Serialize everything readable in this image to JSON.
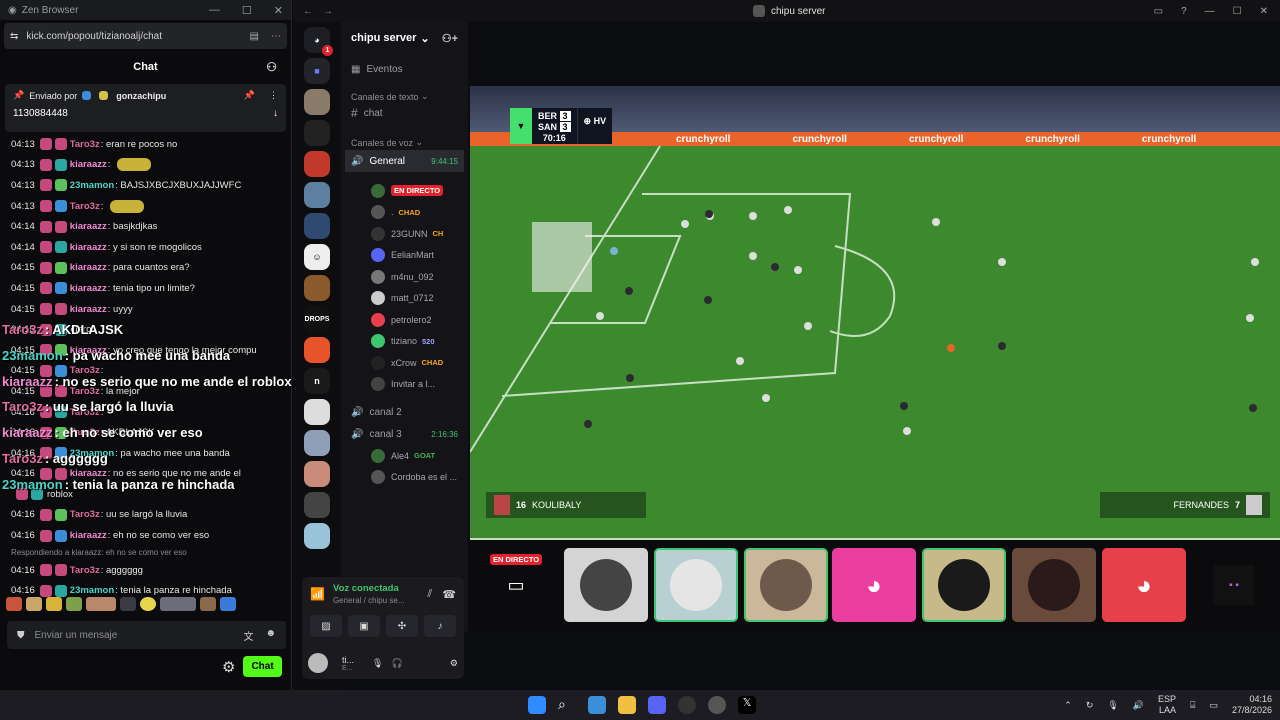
{
  "browser": {
    "title": "Zen Browser",
    "url": "kick.com/popout/tizianoalj/chat"
  },
  "kick": {
    "header": "Chat",
    "pinned": {
      "label": "Enviado por",
      "user": "gonzachipu",
      "text": "1130884448"
    },
    "messages": [
      {
        "time": "04:13",
        "user": "Taro3z",
        "color": "#e06c9f",
        "text": "eran re pocos no"
      },
      {
        "time": "04:13",
        "user": "kiaraazz",
        "color": "#f08ad0",
        "text": "",
        "emote": true
      },
      {
        "time": "04:13",
        "user": "23mamon",
        "color": "#4fd3c7",
        "text": "BAJSJXBCJXBUXJAJJWFC"
      },
      {
        "time": "04:13",
        "user": "Taro3z",
        "color": "#e06c9f",
        "text": "",
        "emote": true
      },
      {
        "time": "04:14",
        "user": "kiaraazz",
        "color": "#f08ad0",
        "text": "basjkdjkas"
      },
      {
        "time": "04:14",
        "user": "kiaraazz",
        "color": "#f08ad0",
        "text": "y si son re mogolicos"
      },
      {
        "time": "04:15",
        "user": "kiaraazz",
        "color": "#f08ad0",
        "text": "para cuantos era?"
      },
      {
        "time": "04:15",
        "user": "kiaraazz",
        "color": "#f08ad0",
        "text": "tenia tipo un limite?"
      },
      {
        "time": "04:15",
        "user": "kiaraazz",
        "color": "#f08ad0",
        "text": "uyyy"
      },
      {
        "time": "04:15",
        "user": "",
        "color": "#e06c9f",
        "text": "claro"
      },
      {
        "time": "04:15",
        "user": "kiaraazz",
        "color": "#f08ad0",
        "text": "yo creo que tengo la mejor compu"
      },
      {
        "time": "04:15",
        "user": "Taro3z",
        "color": "#e06c9f",
        "text": ""
      },
      {
        "time": "04:15",
        "user": "Taro3z",
        "color": "#e06c9f",
        "text": "la mejor"
      },
      {
        "time": "04:16",
        "user": "Taro3z",
        "color": "#e06c9f",
        "text": ""
      },
      {
        "time": "04:16",
        "user": "Taro3z",
        "color": "#e06c9f",
        "text": "AKDLAJSK"
      },
      {
        "time": "04:16",
        "user": "23mamon",
        "color": "#4fd3c7",
        "text": "pa wacho mee una banda"
      },
      {
        "time": "04:16",
        "user": "kiaraazz",
        "color": "#f08ad0",
        "text": "no es serio que no me ande el"
      },
      {
        "time": "",
        "user": "",
        "color": "#ddd",
        "text": "roblox"
      },
      {
        "time": "04:16",
        "user": "Taro3z",
        "color": "#e06c9f",
        "text": "uu se largó la lluvia"
      },
      {
        "time": "04:16",
        "user": "kiaraazz",
        "color": "#f08ad0",
        "text": "eh no se como ver eso"
      }
    ],
    "reply_note": "Respondiendo a kiaraazz: eh no se como ver eso",
    "messages_tail": [
      {
        "time": "04:16",
        "user": "Taro3z",
        "color": "#e06c9f",
        "text": "agggggg"
      },
      {
        "time": "04:16",
        "user": "23mamon",
        "color": "#4fd3c7",
        "text": "tenia la panza re hinchada"
      }
    ],
    "overlay": [
      {
        "user": "Taro3z",
        "color": "#e06c9f",
        "text": "AKDLAJSK"
      },
      {
        "user": "23mamon",
        "color": "#4fd3c7",
        "text": "pa wacho mee una banda"
      },
      {
        "user": "kiaraazz",
        "color": "#f08ad0",
        "text": "no es serio que no me ande el roblox"
      },
      {
        "user": "Taro3z",
        "color": "#e06c9f",
        "text": "uu se largó la lluvia"
      },
      {
        "user": "kiaraazz",
        "color": "#f08ad0",
        "text": "eh no se como ver eso"
      },
      {
        "user": "Taro3z",
        "color": "#e06c9f",
        "text": "agggggg"
      },
      {
        "user": "23mamon",
        "color": "#4fd3c7",
        "text": "tenia la panza re hinchada"
      }
    ],
    "send_placeholder": "Enviar un mensaje",
    "send_button": "Chat"
  },
  "discord": {
    "window_title": "chipu server",
    "server_name": "chipu server",
    "events": "Eventos",
    "text_category": "Canales de texto",
    "text_channel": "chat",
    "voice_category": "Canales de voz",
    "voice_channels": [
      {
        "name": "General",
        "timer": "9:44:15"
      },
      {
        "name": "canal 2",
        "timer": ""
      },
      {
        "name": "canal 3",
        "timer": "2:16:36"
      }
    ],
    "general_users": [
      {
        "name": "",
        "tag": "EN DIRECTO",
        "tag_color": "#e0232e"
      },
      {
        "name": ".",
        "tag": "CHAD",
        "tag_color": "#f5a623"
      },
      {
        "name": "23GUNN",
        "tag": "CH",
        "tag_color": "#f5a623"
      },
      {
        "name": "EelianMart",
        "tag": "",
        "tag_color": "#f5a623"
      },
      {
        "name": "m4nu_092",
        "tag": "",
        "tag_color": "#888"
      },
      {
        "name": "matt_0712",
        "tag": "",
        "tag_color": "#888"
      },
      {
        "name": "petrolero2",
        "tag": "",
        "tag_color": "#888"
      },
      {
        "name": "tiziano",
        "tag": "520",
        "tag_color": "#9aa2ff"
      },
      {
        "name": "xCrow",
        "tag": "CHAD",
        "tag_color": "#f5a623"
      },
      {
        "name": "Invitar a l...",
        "tag": "",
        "tag_color": "#888"
      }
    ],
    "canal3_users": [
      {
        "name": "Ale4",
        "tag": "GOAT",
        "tag_color": "#4caf50"
      },
      {
        "name": "Cordoba es el ...",
        "tag": "",
        "tag_color": "#888"
      }
    ],
    "voice_panel": {
      "status": "Voz conectada",
      "where": "General / chipu se..."
    },
    "user": {
      "name": "ti...",
      "sub": "E..."
    },
    "rail_badge": "1",
    "rail_labels": [
      "DROPS",
      "n"
    ],
    "live_label": "EN DIRECTO"
  },
  "game": {
    "team1": "BER",
    "score1": "3",
    "team2": "SAN",
    "score2": "3",
    "clock": "70:16",
    "tag": "HV",
    "sponsor": "crunchyroll",
    "player_left_num": "16",
    "player_left": "KOULIBALY",
    "player_right": "FERNANDES",
    "player_right_num": "7"
  },
  "taskbar": {
    "lang1": "ESP",
    "lang2": "LAA",
    "time": "04:16",
    "date": "27/8/2026"
  }
}
